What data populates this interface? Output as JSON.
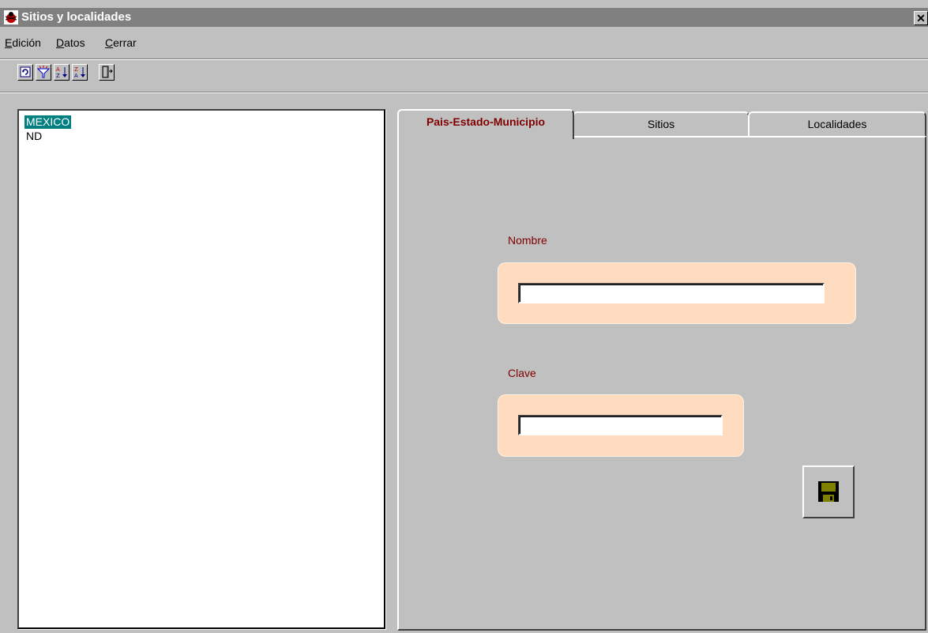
{
  "window": {
    "title": "Sitios y localidades",
    "close_glyph": "✕"
  },
  "menu": {
    "items": [
      "Edición",
      "Datos",
      "Cerrar"
    ]
  },
  "toolbar": {
    "buttons": [
      "refresh-icon",
      "filter-icon",
      "sort-ascending-icon",
      "sort-descending-icon",
      "exit-door-icon"
    ]
  },
  "list": {
    "items": [
      "MEXICO",
      "ND"
    ],
    "selected_index": 0
  },
  "tabs": [
    {
      "label": "Pais-Estado-Municipio",
      "active": true
    },
    {
      "label": "Sitios",
      "active": false
    },
    {
      "label": "Localidades",
      "active": false
    }
  ],
  "form": {
    "nombre_label": "Nombre",
    "nombre_value": "",
    "clave_label": "Clave",
    "clave_value": ""
  },
  "save_button": {
    "icon": "floppy-disk-icon"
  },
  "colors": {
    "selection": "#008080",
    "tab_active_text": "#800000",
    "field_label": "#800000",
    "field_panel": "#ffdcc0"
  }
}
